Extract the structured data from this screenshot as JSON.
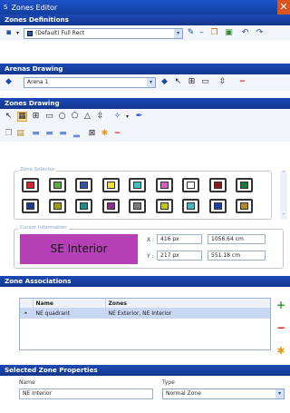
{
  "window": {
    "title": "Zones Editor",
    "close_icon": "close-icon"
  },
  "zone_definitions": {
    "header": "Zones Definitions",
    "combo_value": "(Default) Full Rect"
  },
  "arenas_drawing": {
    "header": "Arenas Drawing",
    "arena_value": "Arena 1"
  },
  "zones_drawing": {
    "header": "Zones Drawing",
    "zone_selector_label": "Zone Selector",
    "swatch_row1": [
      "#d6242b",
      "#5aae42",
      "#2c54b3",
      "#f0e235",
      "#3cc4c4",
      "#d660c0",
      "#ffffff",
      "#8a1a1a",
      "#1e7a3a"
    ],
    "swatch_row2": [
      "#1f3a8a",
      "#9c9c1a",
      "#1e8a8a",
      "#8a2a8a",
      "#7a7a7a",
      "#c4c41e",
      "#4ab4c4",
      "#1f3fa8",
      "#b8862a"
    ],
    "cursor_info_label": "Cursor Information",
    "cursor_zone": "SE Interior",
    "x_label": "X :",
    "y_label": "Y :",
    "x_px": "416 px",
    "y_px": "217 px",
    "x_cm": "1056.64 cm",
    "y_cm": "551.18 cm"
  },
  "zone_associations": {
    "header": "Zone Associations",
    "columns": [
      "Name",
      "Zones"
    ],
    "rows": [
      {
        "name": "NE quadrant",
        "zones": "NE Exterior, NE Interior"
      }
    ]
  },
  "selected_zone": {
    "header": "Selected Zone Properties",
    "name_label": "Name",
    "name_value": "NE Interior",
    "type_label": "Type",
    "type_value": "Normal Zone"
  },
  "colors": {
    "accent": "#1c49b6",
    "cursor_zone_bg": "#b53fb5"
  }
}
